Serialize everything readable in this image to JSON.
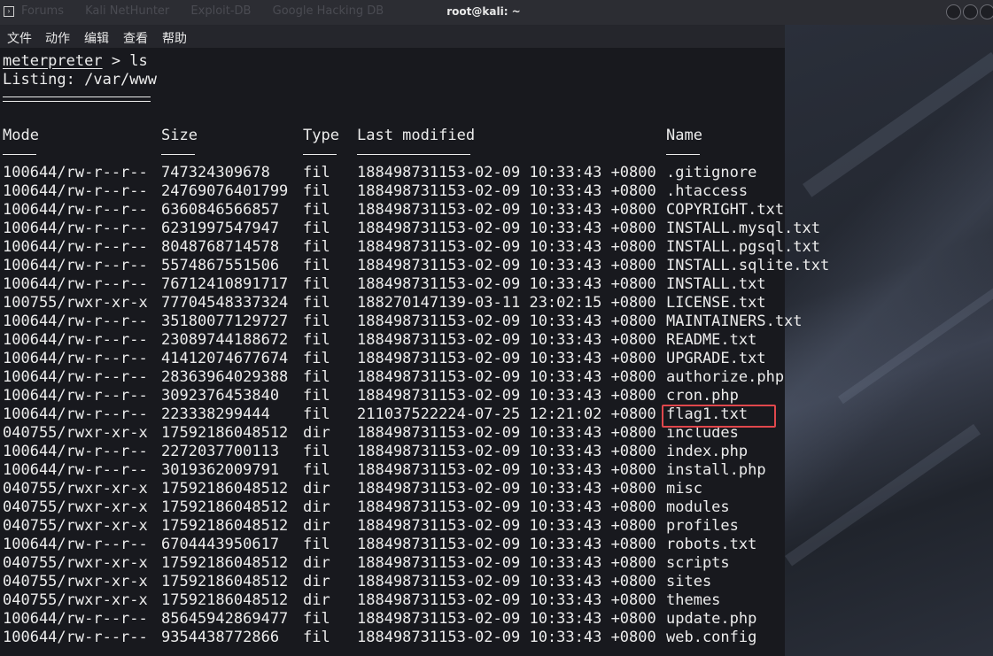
{
  "window": {
    "title": "root@kali: ~",
    "background_tabs": [
      "Forums",
      "Kali NetHunter",
      "Exploit-DB",
      "Google Hacking DB"
    ]
  },
  "menu": {
    "items": [
      "文件",
      "动作",
      "编辑",
      "查看",
      "帮助"
    ]
  },
  "terminal": {
    "prompt": "meterpreter",
    "command_suffix": " > ls",
    "listing": "Listing: /var/www",
    "headers": {
      "mode": "Mode",
      "size": "Size",
      "type": "Type",
      "modified": "Last modified",
      "name": "Name"
    },
    "rows": [
      {
        "mode": "100644/rw-r--r--",
        "size": "747324309678",
        "type": "fil",
        "modified": "188498731153-02-09 10:33:43 +0800",
        "name": ".gitignore"
      },
      {
        "mode": "100644/rw-r--r--",
        "size": "24769076401799",
        "type": "fil",
        "modified": "188498731153-02-09 10:33:43 +0800",
        "name": ".htaccess"
      },
      {
        "mode": "100644/rw-r--r--",
        "size": "6360846566857",
        "type": "fil",
        "modified": "188498731153-02-09 10:33:43 +0800",
        "name": "COPYRIGHT.txt"
      },
      {
        "mode": "100644/rw-r--r--",
        "size": "6231997547947",
        "type": "fil",
        "modified": "188498731153-02-09 10:33:43 +0800",
        "name": "INSTALL.mysql.txt"
      },
      {
        "mode": "100644/rw-r--r--",
        "size": "8048768714578",
        "type": "fil",
        "modified": "188498731153-02-09 10:33:43 +0800",
        "name": "INSTALL.pgsql.txt"
      },
      {
        "mode": "100644/rw-r--r--",
        "size": "5574867551506",
        "type": "fil",
        "modified": "188498731153-02-09 10:33:43 +0800",
        "name": "INSTALL.sqlite.txt"
      },
      {
        "mode": "100644/rw-r--r--",
        "size": "76712410891717",
        "type": "fil",
        "modified": "188498731153-02-09 10:33:43 +0800",
        "name": "INSTALL.txt"
      },
      {
        "mode": "100755/rwxr-xr-x",
        "size": "77704548337324",
        "type": "fil",
        "modified": "188270147139-03-11 23:02:15 +0800",
        "name": "LICENSE.txt"
      },
      {
        "mode": "100644/rw-r--r--",
        "size": "35180077129727",
        "type": "fil",
        "modified": "188498731153-02-09 10:33:43 +0800",
        "name": "MAINTAINERS.txt"
      },
      {
        "mode": "100644/rw-r--r--",
        "size": "23089744188672",
        "type": "fil",
        "modified": "188498731153-02-09 10:33:43 +0800",
        "name": "README.txt"
      },
      {
        "mode": "100644/rw-r--r--",
        "size": "41412074677674",
        "type": "fil",
        "modified": "188498731153-02-09 10:33:43 +0800",
        "name": "UPGRADE.txt"
      },
      {
        "mode": "100644/rw-r--r--",
        "size": "28363964029388",
        "type": "fil",
        "modified": "188498731153-02-09 10:33:43 +0800",
        "name": "authorize.php"
      },
      {
        "mode": "100644/rw-r--r--",
        "size": "3092376453840",
        "type": "fil",
        "modified": "188498731153-02-09 10:33:43 +0800",
        "name": "cron.php"
      },
      {
        "mode": "100644/rw-r--r--",
        "size": "223338299444",
        "type": "fil",
        "modified": "211037522224-07-25 12:21:02 +0800",
        "name": "flag1.txt"
      },
      {
        "mode": "040755/rwxr-xr-x",
        "size": "17592186048512",
        "type": "dir",
        "modified": "188498731153-02-09 10:33:43 +0800",
        "name": "includes"
      },
      {
        "mode": "100644/rw-r--r--",
        "size": "2272037700113",
        "type": "fil",
        "modified": "188498731153-02-09 10:33:43 +0800",
        "name": "index.php"
      },
      {
        "mode": "100644/rw-r--r--",
        "size": "3019362009791",
        "type": "fil",
        "modified": "188498731153-02-09 10:33:43 +0800",
        "name": "install.php"
      },
      {
        "mode": "040755/rwxr-xr-x",
        "size": "17592186048512",
        "type": "dir",
        "modified": "188498731153-02-09 10:33:43 +0800",
        "name": "misc"
      },
      {
        "mode": "040755/rwxr-xr-x",
        "size": "17592186048512",
        "type": "dir",
        "modified": "188498731153-02-09 10:33:43 +0800",
        "name": "modules"
      },
      {
        "mode": "040755/rwxr-xr-x",
        "size": "17592186048512",
        "type": "dir",
        "modified": "188498731153-02-09 10:33:43 +0800",
        "name": "profiles"
      },
      {
        "mode": "100644/rw-r--r--",
        "size": "6704443950617",
        "type": "fil",
        "modified": "188498731153-02-09 10:33:43 +0800",
        "name": "robots.txt"
      },
      {
        "mode": "040755/rwxr-xr-x",
        "size": "17592186048512",
        "type": "dir",
        "modified": "188498731153-02-09 10:33:43 +0800",
        "name": "scripts"
      },
      {
        "mode": "040755/rwxr-xr-x",
        "size": "17592186048512",
        "type": "dir",
        "modified": "188498731153-02-09 10:33:43 +0800",
        "name": "sites"
      },
      {
        "mode": "040755/rwxr-xr-x",
        "size": "17592186048512",
        "type": "dir",
        "modified": "188498731153-02-09 10:33:43 +0800",
        "name": "themes"
      },
      {
        "mode": "100644/rw-r--r--",
        "size": "85645942869477",
        "type": "fil",
        "modified": "188498731153-02-09 10:33:43 +0800",
        "name": "update.php"
      },
      {
        "mode": "100644/rw-r--r--",
        "size": "9354438772866",
        "type": "fil",
        "modified": "188498731153-02-09 10:33:43 +0800",
        "name": "web.config"
      }
    ],
    "highlighted_name": "flag1.txt"
  },
  "colors": {
    "terminal_bg": "#18191e",
    "text": "#ececec",
    "highlight": "#e0474c"
  }
}
